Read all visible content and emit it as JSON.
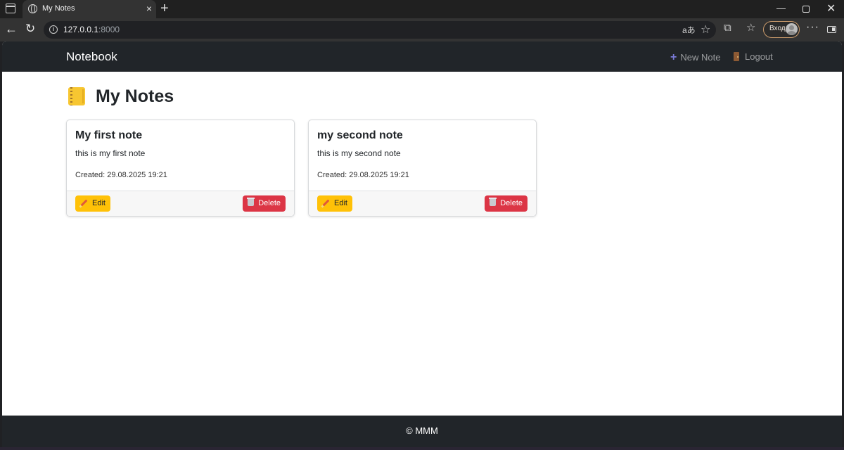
{
  "browser": {
    "tab_title": "My Notes",
    "url_host": "127.0.0.1",
    "url_port": ":8000",
    "profile_label": "Вход"
  },
  "navbar": {
    "brand": "Notebook",
    "new_note": "New Note",
    "logout": "Logout"
  },
  "page": {
    "title": "My Notes"
  },
  "notes": [
    {
      "title": "My first note",
      "text": "this is my first note",
      "created": "Created: 29.08.2025 19:21",
      "edit_label": "Edit",
      "delete_label": "Delete"
    },
    {
      "title": "my second note",
      "text": "this is my second note",
      "created": "Created: 29.08.2025 19:21",
      "edit_label": "Edit",
      "delete_label": "Delete"
    }
  ],
  "footer": {
    "text": "© MMM"
  },
  "colors": {
    "navbar_bg": "#212529",
    "edit_button": "#ffc107",
    "delete_button": "#dc3545"
  }
}
